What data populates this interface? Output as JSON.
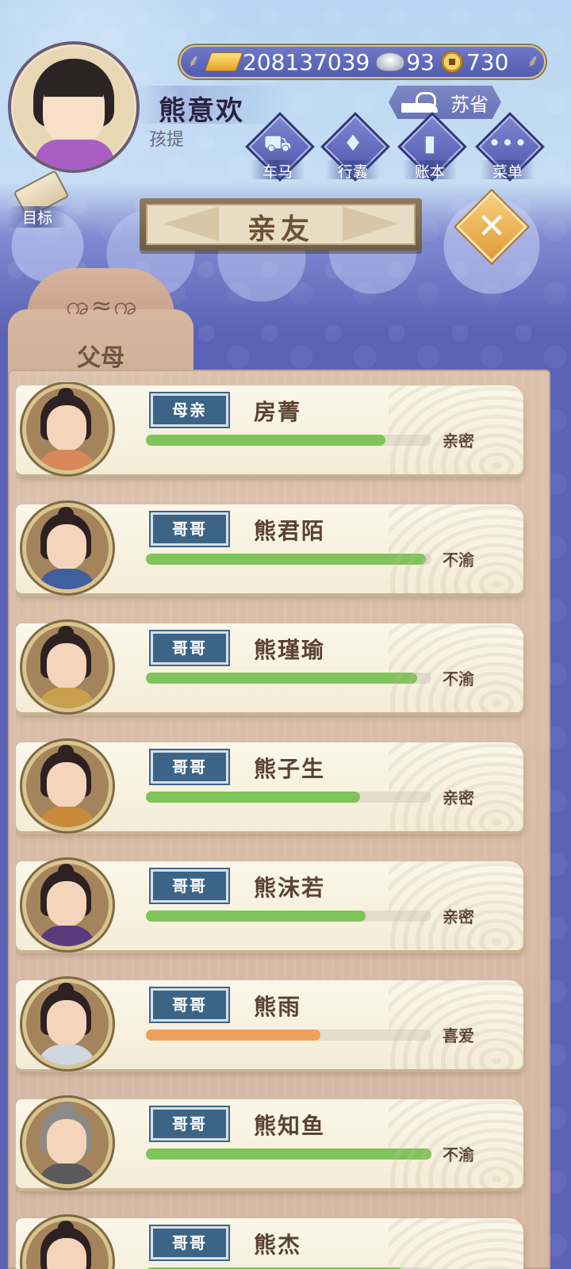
{
  "header": {
    "player_name": "熊意欢",
    "player_title": "孩提",
    "currency": {
      "gold": "208137039",
      "silver": "93",
      "coin": "730"
    },
    "region": "苏省",
    "goal_label": "目标",
    "menu": [
      {
        "label": "车马",
        "icon": "carriage-icon"
      },
      {
        "label": "行囊",
        "icon": "bundle-icon"
      },
      {
        "label": "账本",
        "icon": "ledger-icon"
      },
      {
        "label": "菜单",
        "icon": "more-icon"
      }
    ]
  },
  "page": {
    "title": "亲友",
    "tab_label": "父母"
  },
  "colors": {
    "green_bar": "#7ec45a",
    "orange_bar": "#eda15d",
    "badge": "#3c6486"
  },
  "relatives": [
    {
      "role": "母亲",
      "name": "房菁",
      "affection": 0.84,
      "status": "亲密",
      "bar_color": "#7ec45a",
      "robe": "#d9885b"
    },
    {
      "role": "哥哥",
      "name": "熊君陌",
      "affection": 0.98,
      "status": "不渝",
      "bar_color": "#7ec45a",
      "robe": "#3f5f9e"
    },
    {
      "role": "哥哥",
      "name": "熊瑾瑜",
      "affection": 0.95,
      "status": "不渝",
      "bar_color": "#7ec45a",
      "robe": "#c8a04d"
    },
    {
      "role": "哥哥",
      "name": "熊子生",
      "affection": 0.75,
      "status": "亲密",
      "bar_color": "#7ec45a",
      "robe": "#c78a3a"
    },
    {
      "role": "哥哥",
      "name": "熊沫若",
      "affection": 0.77,
      "status": "亲密",
      "bar_color": "#7ec45a",
      "robe": "#5a3a7a"
    },
    {
      "role": "哥哥",
      "name": "熊雨",
      "affection": 0.61,
      "status": "喜爱",
      "bar_color": "#eda15d",
      "robe": "#cfd7e3"
    },
    {
      "role": "哥哥",
      "name": "熊知鱼",
      "affection": 1.0,
      "status": "不渝",
      "bar_color": "#7ec45a",
      "robe": "#5a5a5a"
    },
    {
      "role": "哥哥",
      "name": "熊杰",
      "affection": 0.9,
      "status": "",
      "bar_color": "#7ec45a",
      "robe": "#7a5a3a"
    }
  ]
}
